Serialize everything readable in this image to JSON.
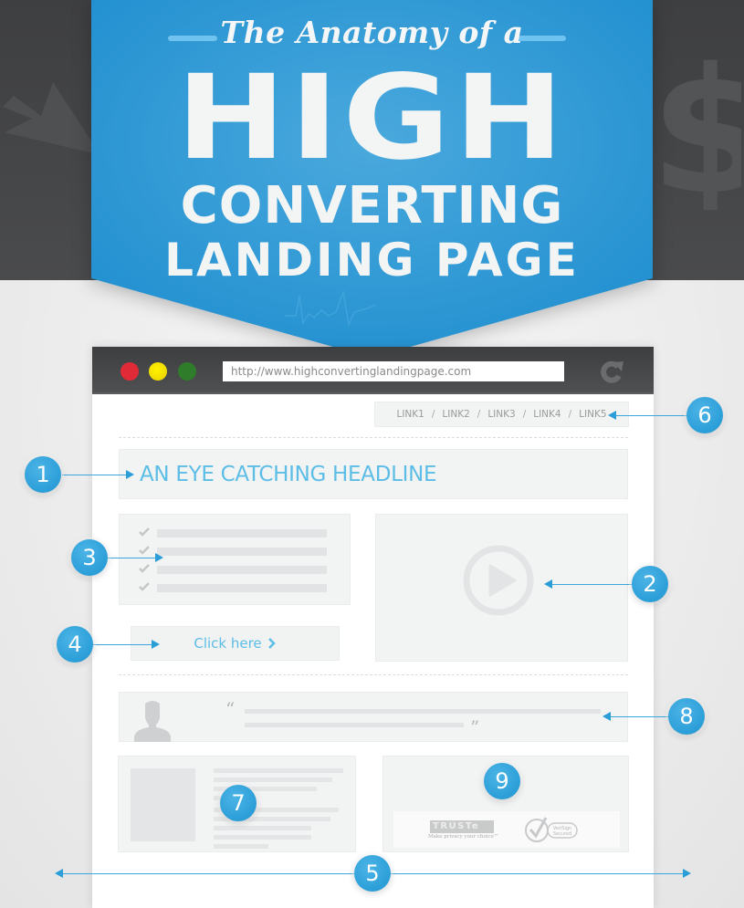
{
  "banner": {
    "script_title": "The Anatomy of a",
    "line1": "HIGH",
    "line2": "CONVERTING",
    "line3": "LANDING PAGE"
  },
  "browser": {
    "url": "http://www.highconvertinglandingpage.com",
    "window_controls": [
      "close",
      "minimize",
      "maximize"
    ],
    "refresh_icon": "refresh-icon"
  },
  "page": {
    "nav_links": [
      "LINK1",
      "LINK2",
      "LINK3",
      "LINK4",
      "LINK5"
    ],
    "nav_separator": "/",
    "headline": "AN EYE CATCHING HEADLINE",
    "cta_label": "Click here",
    "cta_icon": "chevron-right-icon",
    "checklist_items": 4,
    "video_icon": "play-icon",
    "testimonial": {
      "open_quote": "“",
      "close_quote": "”",
      "avatar_icon": "user-silhouette-icon"
    },
    "trust_badges": {
      "truste_logo": "TRUSTe",
      "truste_tagline": "Make privacy your choice™",
      "verisign": "VeriSign Secured"
    }
  },
  "callouts": [
    {
      "number": "1",
      "target": "headline"
    },
    {
      "number": "2",
      "target": "video"
    },
    {
      "number": "3",
      "target": "benefits-list"
    },
    {
      "number": "4",
      "target": "call-to-action"
    },
    {
      "number": "5",
      "target": "page-width"
    },
    {
      "number": "6",
      "target": "navigation-links"
    },
    {
      "number": "7",
      "target": "content-article"
    },
    {
      "number": "8",
      "target": "testimonial"
    },
    {
      "number": "9",
      "target": "trust-badges"
    }
  ],
  "colors": {
    "banner_blue": "#2a97d4",
    "accent_blue": "#5cbde6",
    "marker_blue": "#2b9ed8",
    "dark_band": "#434446",
    "close_red": "#e02a37",
    "minimize_yellow": "#f2dc00",
    "maximize_green": "#2f7d2a"
  }
}
